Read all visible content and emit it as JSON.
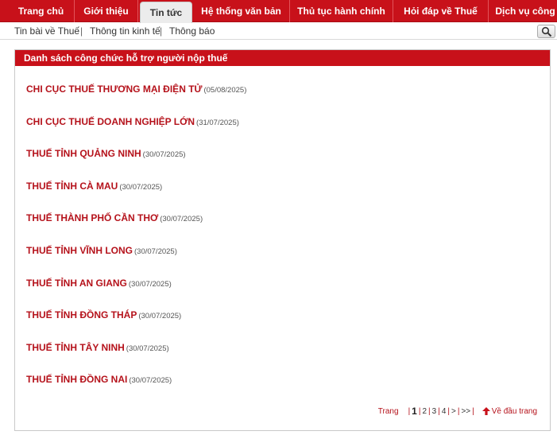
{
  "nav": {
    "tabs": [
      {
        "label": "Trang chủ"
      },
      {
        "label": "Giới thiệu"
      },
      {
        "label": "Tin tức"
      },
      {
        "label": "Hệ thống văn bản"
      },
      {
        "label": "Thủ tục hành chính"
      },
      {
        "label": "Hỏi đáp về Thuế"
      },
      {
        "label": "Dịch vụ công"
      }
    ],
    "active_tab": "Tin tức"
  },
  "subnav": {
    "items": [
      {
        "label": "Tin bài về Thuế"
      },
      {
        "label": "Thông tin kinh tế"
      },
      {
        "label": "Thông báo"
      }
    ],
    "separator": "|"
  },
  "panel": {
    "title": "Danh sách công chức hỗ trợ người nộp thuế",
    "items": [
      {
        "title": "CHI CỤC THUẾ THƯƠNG MẠI ĐIỆN TỬ",
        "date": "(05/08/2025)"
      },
      {
        "title": "CHI CỤC THUẾ DOANH NGHIỆP LỚN",
        "date": "(31/07/2025)"
      },
      {
        "title": "THUẾ TỈNH QUẢNG NINH",
        "date": "(30/07/2025)"
      },
      {
        "title": "THUẾ TỈNH CÀ MAU",
        "date": "(30/07/2025)"
      },
      {
        "title": "THUẾ THÀNH PHỐ CẦN THƠ",
        "date": "(30/07/2025)"
      },
      {
        "title": "THUẾ TỈNH VĨNH LONG",
        "date": "(30/07/2025)"
      },
      {
        "title": "THUẾ TỈNH AN GIANG",
        "date": "(30/07/2025)"
      },
      {
        "title": "THUẾ TỈNH ĐỒNG THÁP",
        "date": "(30/07/2025)"
      },
      {
        "title": "THUẾ TỈNH TÂY NINH",
        "date": "(30/07/2025)"
      },
      {
        "title": "THUẾ TỈNH ĐỒNG NAI",
        "date": "(30/07/2025)"
      }
    ]
  },
  "pager": {
    "label": "Trang",
    "pages": [
      "1",
      "2",
      "3",
      "4",
      ">",
      ">>"
    ],
    "current": "1",
    "back_to_top": "Về đầu trang"
  },
  "colors": {
    "brand_red": "#c8111a",
    "link_red": "#b5121b"
  },
  "icons": {
    "search": "search-icon",
    "back_to_top": "arrow-up-icon"
  }
}
